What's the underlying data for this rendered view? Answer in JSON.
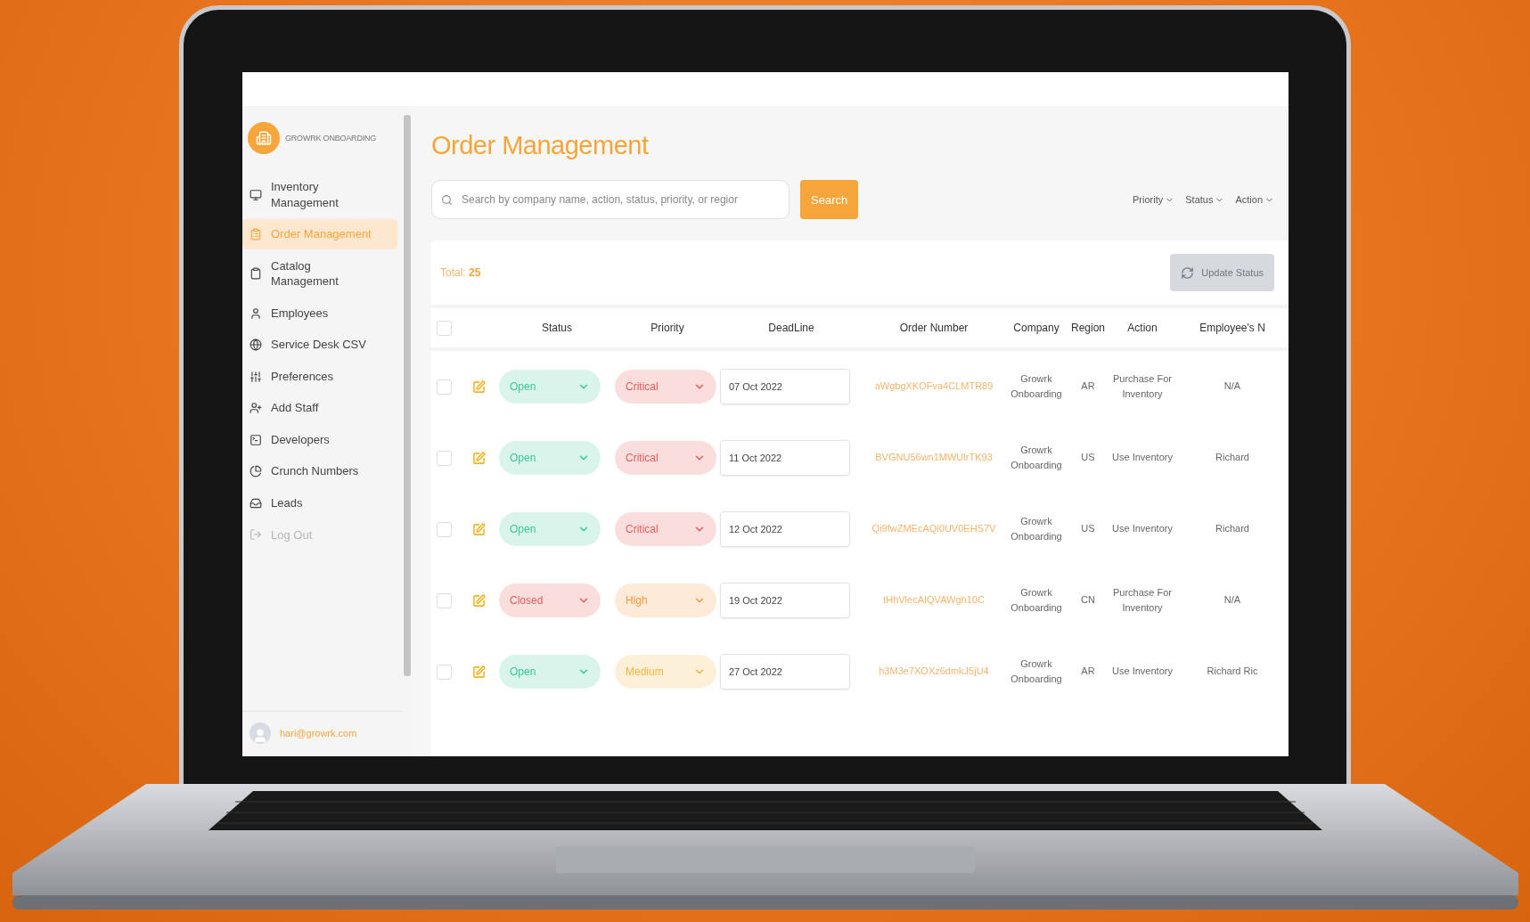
{
  "app": {
    "logo_text": "GROWRK ONBOARDING"
  },
  "sidebar": {
    "items": [
      {
        "label": "Inventory Management",
        "selected": false,
        "disabled": false
      },
      {
        "label": "Order Management",
        "selected": true,
        "disabled": false
      },
      {
        "label": "Catalog Management",
        "selected": false,
        "disabled": false
      },
      {
        "label": "Employees",
        "selected": false,
        "disabled": false
      },
      {
        "label": "Service Desk CSV",
        "selected": false,
        "disabled": false
      },
      {
        "label": "Preferences",
        "selected": false,
        "disabled": false
      },
      {
        "label": "Add Staff",
        "selected": false,
        "disabled": false
      },
      {
        "label": "Developers",
        "selected": false,
        "disabled": false
      },
      {
        "label": "Crunch Numbers",
        "selected": false,
        "disabled": false
      },
      {
        "label": "Leads",
        "selected": false,
        "disabled": false
      },
      {
        "label": "Log Out",
        "selected": false,
        "disabled": true
      }
    ],
    "user_email": "hari@growrk.com"
  },
  "page": {
    "title": "Order Management"
  },
  "search": {
    "placeholder": "Search by company name, action, status, priority, or regior",
    "button": "Search"
  },
  "filters": [
    "Priority",
    "Status",
    "Action"
  ],
  "summary": {
    "total_label": "Total:",
    "total": "25",
    "update_button": {
      "label": "Update Status",
      "disabled": true
    }
  },
  "table": {
    "select_all_checked": false,
    "columns": [
      "Status",
      "Priority",
      "DeadLine",
      "Order Number",
      "Company",
      "Region",
      "Action",
      "Employee's N"
    ],
    "rows": [
      {
        "checked": false,
        "status": {
          "label": "Open",
          "color": "#3cc79a"
        },
        "priority": {
          "label": "Critical",
          "color": "#e85a5a"
        },
        "deadline": "07 Oct 2022",
        "order_number": "aWgbgXKOFva4CLMTR89",
        "company": "Growrk Onboarding",
        "region": "AR",
        "action": "Purchase For Inventory",
        "employee": "N/A"
      },
      {
        "checked": false,
        "status": {
          "label": "Open",
          "color": "#3cc79a"
        },
        "priority": {
          "label": "Critical",
          "color": "#e85a5a"
        },
        "deadline": "11 Oct 2022",
        "order_number": "BVGNU56wn1MWUlrTK93",
        "company": "Growrk Onboarding",
        "region": "US",
        "action": "Use Inventory",
        "employee": "Richard"
      },
      {
        "checked": false,
        "status": {
          "label": "Open",
          "color": "#3cc79a"
        },
        "priority": {
          "label": "Critical",
          "color": "#e85a5a"
        },
        "deadline": "12 Oct 2022",
        "order_number": "Qi9fwZMEcAQi0UV0EHS7V",
        "company": "Growrk Onboarding",
        "region": "US",
        "action": "Use Inventory",
        "employee": "Richard"
      },
      {
        "checked": false,
        "status": {
          "label": "Closed",
          "color": "#e85a5a"
        },
        "priority": {
          "label": "High",
          "color": "#f39a3c"
        },
        "deadline": "19 Oct 2022",
        "order_number": "tHhVlecAIQVAWgh10C",
        "company": "Growrk Onboarding",
        "region": "CN",
        "action": "Purchase For Inventory",
        "employee": "N/A"
      },
      {
        "checked": false,
        "status": {
          "label": "Open",
          "color": "#3cc79a"
        },
        "priority": {
          "label": "Medium",
          "color": "#f2b53c"
        },
        "deadline": "27 Oct 2022",
        "order_number": "h3M3e7XOXz6dmkJ5jU4",
        "company": "Growrk Onboarding",
        "region": "AR",
        "action": "Use Inventory",
        "employee": "Richard Ric"
      }
    ]
  }
}
